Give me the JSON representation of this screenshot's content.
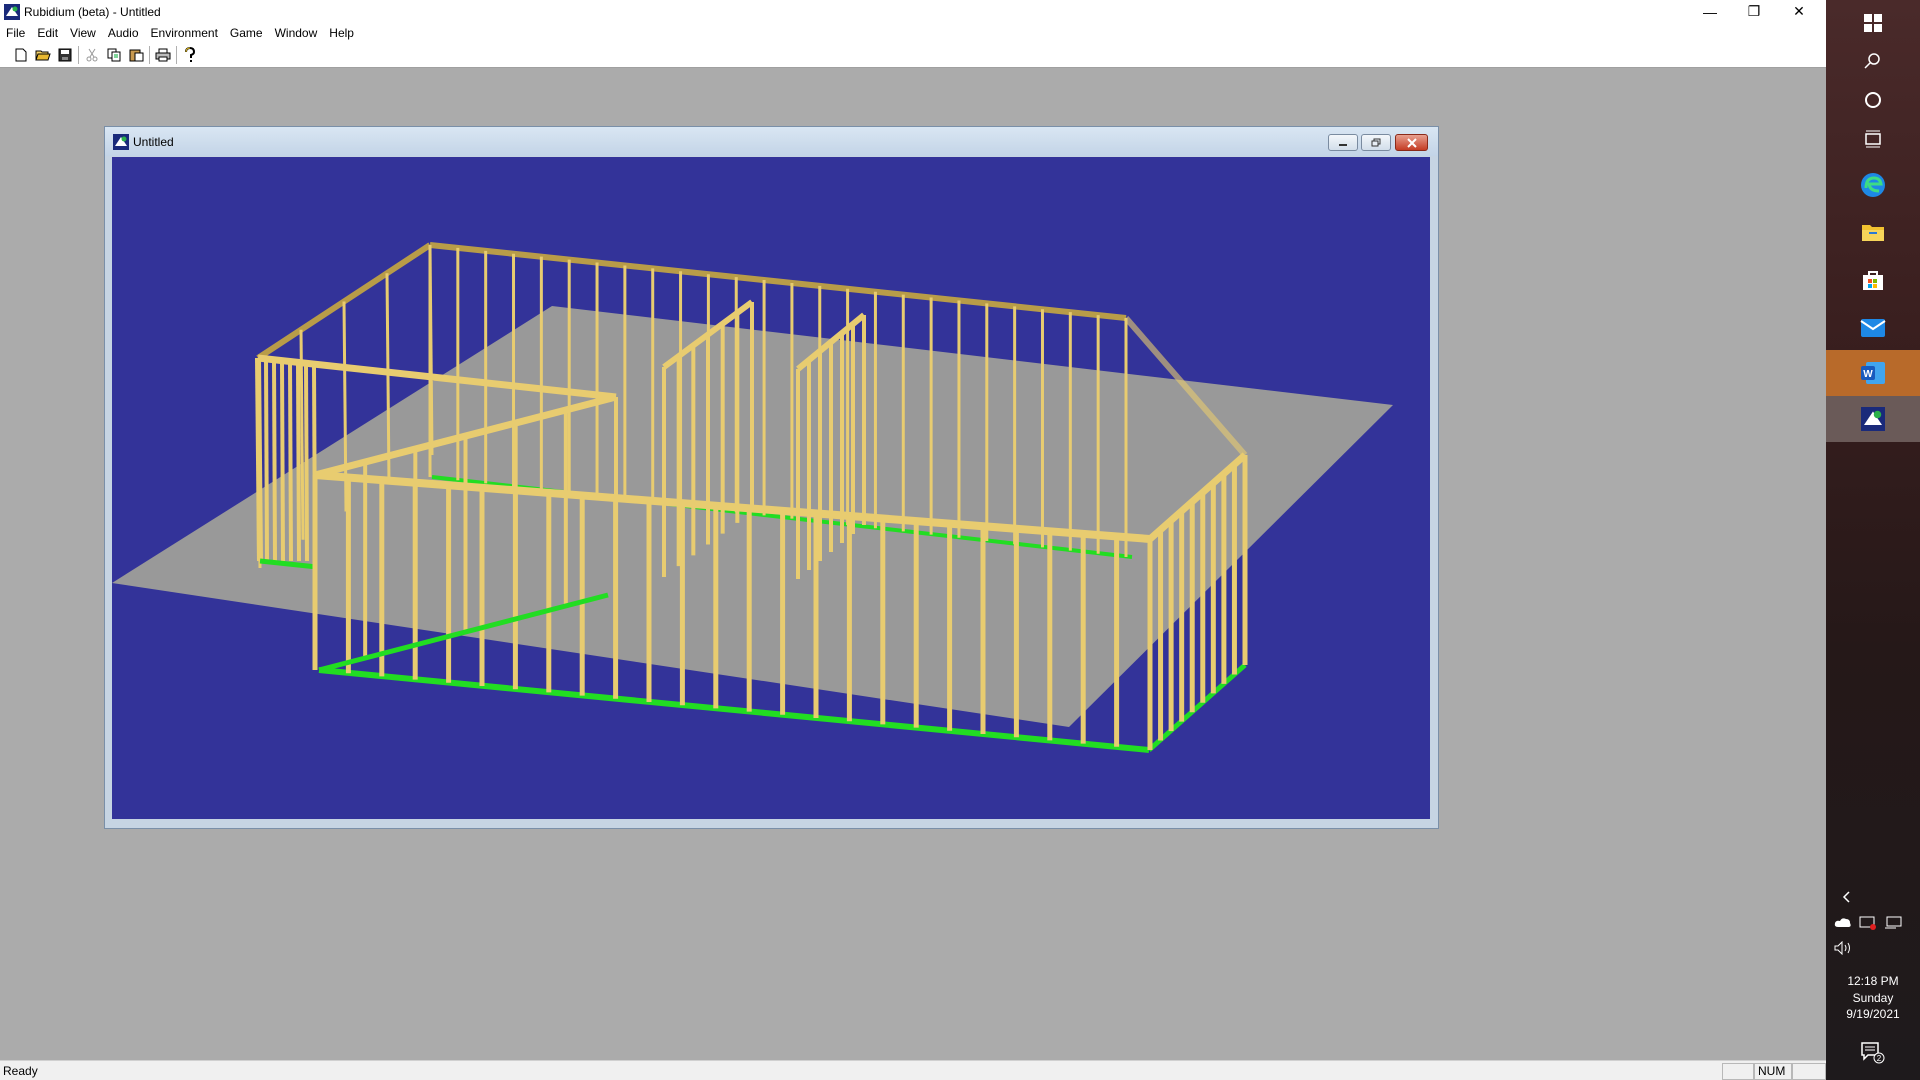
{
  "window": {
    "title": "Rubidium (beta) - Untitled",
    "minimize": "—",
    "restore": "❐",
    "close": "✕"
  },
  "menu": [
    "File",
    "Edit",
    "View",
    "Audio",
    "Environment",
    "Game",
    "Window",
    "Help"
  ],
  "toolbar": [
    "new-file",
    "open-folder",
    "save",
    "cut",
    "copy",
    "paste",
    "print",
    "help"
  ],
  "child_window": {
    "title": "Untitled"
  },
  "viewport": {
    "background": "#333399",
    "ground_color": "#999999",
    "frame_color": "#e8cc70",
    "sill_color": "#22dd22"
  },
  "status": {
    "text": "Ready",
    "num": "NUM"
  },
  "taskbar": {
    "time": "12:18 PM",
    "day": "Sunday",
    "date": "9/19/2021",
    "notifications": "2"
  }
}
